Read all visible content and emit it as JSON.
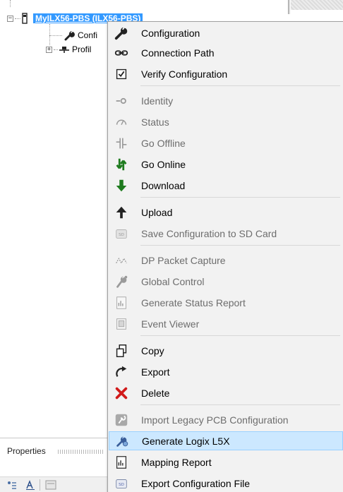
{
  "tree": {
    "device_label": "MyILX56-PBS (ILX56-PBS)",
    "config_child": "Confi",
    "profibus_child": "Profil",
    "expand_glyph": "−",
    "collapsed_glyph": "+"
  },
  "properties": {
    "title": "Properties",
    "sort_icon": "sort-categorized-icon",
    "alpha_icon": "sort-alphabetical-icon"
  },
  "menu": {
    "items": [
      {
        "label": "Configuration",
        "icon": "wrench-icon",
        "enabled": true
      },
      {
        "label": "Connection Path",
        "icon": "link-icon",
        "enabled": true
      },
      {
        "label": "Verify Configuration",
        "icon": "checkbox-icon",
        "enabled": true
      },
      {
        "label": "Identity",
        "icon": "identity-icon",
        "enabled": false
      },
      {
        "label": "Status",
        "icon": "status-icon",
        "enabled": false
      },
      {
        "label": "Go Offline",
        "icon": "go-offline-icon",
        "enabled": false
      },
      {
        "label": "Go Online",
        "icon": "go-online-icon",
        "enabled": true
      },
      {
        "label": "Download",
        "icon": "download-arrow-icon",
        "enabled": true
      },
      {
        "label": "Upload",
        "icon": "upload-arrow-icon",
        "enabled": true
      },
      {
        "label": "Save Configuration to SD Card",
        "icon": "sd-card-icon",
        "enabled": false
      },
      {
        "label": "DP Packet Capture",
        "icon": "packet-capture-icon",
        "enabled": false
      },
      {
        "label": "Global Control",
        "icon": "global-control-icon",
        "enabled": false
      },
      {
        "label": "Generate Status Report",
        "icon": "report-icon",
        "enabled": false
      },
      {
        "label": "Event Viewer",
        "icon": "event-viewer-icon",
        "enabled": false
      },
      {
        "label": "Copy",
        "icon": "copy-icon",
        "enabled": true
      },
      {
        "label": "Export",
        "icon": "export-icon",
        "enabled": true
      },
      {
        "label": "Delete",
        "icon": "delete-x-icon",
        "enabled": true
      },
      {
        "label": "Import Legacy PCB Configuration",
        "icon": "import-legacy-icon",
        "enabled": false
      },
      {
        "label": "Generate Logix L5X",
        "icon": "generate-l5x-icon",
        "enabled": true,
        "highlighted": true
      },
      {
        "label": "Mapping Report",
        "icon": "mapping-report-icon",
        "enabled": true
      },
      {
        "label": "Export Configuration File",
        "icon": "export-config-icon",
        "enabled": true
      }
    ]
  },
  "colors": {
    "selection": "#3399ff",
    "menu_bg": "#f2f2f2",
    "hover_bg": "#cce8ff",
    "hover_border": "#99d1ff",
    "disabled_text": "#6d6d6d",
    "online_green": "#1e7b1e",
    "delete_red": "#d11a1a"
  }
}
